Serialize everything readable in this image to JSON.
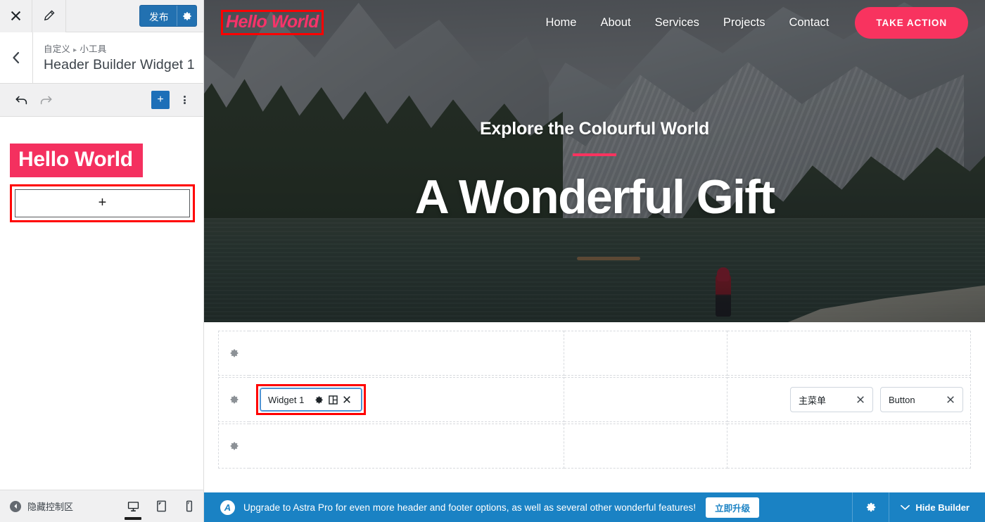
{
  "customizer": {
    "topbar": {
      "close_icon": "close-icon",
      "pencil_icon": "pencil-icon",
      "publish_label": "发布",
      "publish_gear_icon": "gear-icon"
    },
    "breadcrumb": {
      "back_icon": "chevron-left-icon",
      "parent": "自定义",
      "separator": "▸",
      "child": "小工具",
      "title": "Header Builder Widget 1"
    },
    "block_toolbar": {
      "undo_icon": "undo-icon",
      "redo_icon": "redo-icon",
      "add_block_label": "+",
      "more_options_icon": "kebab-menu-icon"
    },
    "widget_area": {
      "heading_text": "Hello World",
      "heading_bg": "#f4305f",
      "appender_label": "+",
      "selection_color": "#ff0000"
    },
    "footer": {
      "collapse_label": "隐藏控制区",
      "devices": [
        {
          "name": "desktop",
          "icon": "desktop-icon",
          "active": true
        },
        {
          "name": "tablet",
          "icon": "tablet-icon",
          "active": false
        },
        {
          "name": "mobile",
          "icon": "mobile-icon",
          "active": false
        }
      ]
    }
  },
  "preview": {
    "site_logo": {
      "text": "Hello World",
      "color": "#f8336a",
      "selected": true
    },
    "nav_items": [
      {
        "label": "Home"
      },
      {
        "label": "About"
      },
      {
        "label": "Services"
      },
      {
        "label": "Projects"
      },
      {
        "label": "Contact"
      }
    ],
    "cta": {
      "label": "TAKE ACTION",
      "bg": "#f8335f"
    },
    "hero": {
      "subtitle": "Explore the Colourful World",
      "title": "A Wonderful Gift",
      "rule_color": "#f8335f"
    }
  },
  "header_builder": {
    "rows": [
      {
        "name": "above-header-row",
        "gear_icon": "gear-icon",
        "items": []
      },
      {
        "name": "primary-header-row",
        "gear_icon": "gear-icon",
        "left_items": [
          {
            "label": "Widget 1",
            "selected": true,
            "icons": [
              "gear-icon",
              "layout-icon",
              "close-icon"
            ]
          }
        ],
        "right_items": [
          {
            "label": "主菜单",
            "close_icon": "close-icon"
          },
          {
            "label": "Button",
            "close_icon": "close-icon"
          }
        ]
      },
      {
        "name": "below-header-row",
        "gear_icon": "gear-icon",
        "items": []
      }
    ]
  },
  "astra_bar": {
    "logo_icon": "astra-logo-icon",
    "message": "Upgrade to Astra Pro for even more header and footer options, as well as several other wonderful features!",
    "upgrade_label": "立即升级",
    "settings_icon": "gear-icon",
    "hide_chevron_icon": "chevron-down-icon",
    "hide_label": "Hide Builder",
    "bg": "#1a82c4"
  }
}
